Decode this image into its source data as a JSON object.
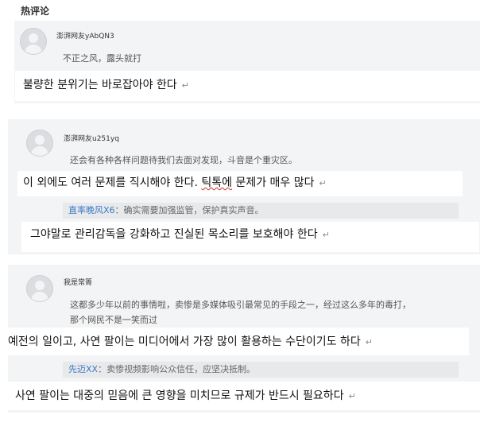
{
  "header": {
    "title": "热评论"
  },
  "comments": [
    {
      "username": "澎湃网友yAbQN3",
      "text": "不正之风，露头就打",
      "translation": "불량한 분위기는 바로잡아야 한다"
    },
    {
      "username": "澎湃网友u251yq",
      "text": "还会有各种各样问题待我们去面对发现，斗音是个重灾区。",
      "translation_part1": "이 외에도 여러 문제를 직시해야 한다. ",
      "translation_word": "틱톡에",
      "translation_part2": " 문제가 매우 많다",
      "reply": {
        "name": "直率晚风X6",
        "text": "：确实需要加强监管，保护真实声音。"
      },
      "reply_translation": "그야말로 관리감독을 강화하고 진실된 목소리를 보호해야 한다"
    },
    {
      "username": "我是常箐",
      "text_line1": "这都多少年以前的事情啦，卖惨是多媒体吸引最常见的手段之一，经过这么多年的毒打，",
      "text_line2": "那个网民不是一笑而过",
      "translation": "예전의 일이고, 사연 팔이는 미디어에서 가장 많이 활용하는 수단이기도 하다",
      "reply": {
        "name": "先迈XX",
        "text": "：卖惨视频影响公众信任，应坚决抵制。"
      },
      "reply_translation": "사연 팔이는 대중의 믿음에 큰 영향을 미치므로 규제가 반드시 필요하다"
    }
  ],
  "return_mark": "↵"
}
